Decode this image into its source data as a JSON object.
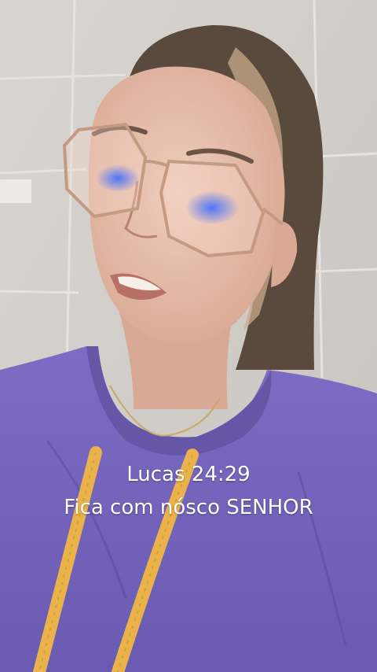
{
  "caption": {
    "line1": "Lucas 24:29",
    "line2": "Fica com nósco SENHOR"
  },
  "colors": {
    "wall": "#d3d0cb",
    "hoodie": "#7a68c0",
    "drawstring": "#e9b24a",
    "hair": "#5a4a3e",
    "skin": "#e6bfae",
    "caption_text": "#ffffff"
  }
}
